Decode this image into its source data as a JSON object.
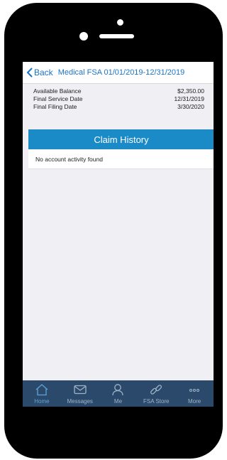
{
  "nav": {
    "back_label": "Back",
    "title": "Medical FSA 01/01/2019-12/31/2019"
  },
  "summary": {
    "rows": [
      {
        "label": "Available Balance",
        "value": "$2,350.00"
      },
      {
        "label": "Final Service Date",
        "value": "12/31/2019"
      },
      {
        "label": "Final Filing Date",
        "value": "3/30/2020"
      }
    ]
  },
  "claim_history": {
    "title": "Claim History",
    "empty_message": "No account activity found"
  },
  "tab_bar": {
    "items": [
      {
        "label": "Home",
        "icon": "home-icon",
        "active": true
      },
      {
        "label": "Messages",
        "icon": "envelope-icon",
        "active": false
      },
      {
        "label": "Me",
        "icon": "person-icon",
        "active": false
      },
      {
        "label": "FSA Store",
        "icon": "link-icon",
        "active": false
      },
      {
        "label": "More",
        "icon": "ellipsis-icon",
        "active": false
      }
    ]
  },
  "colors": {
    "accent_blue": "#1a73c8",
    "header_blue": "#1b8bc8",
    "tab_bar_bg": "#2b4a6b",
    "screen_bg": "#efeff4"
  }
}
